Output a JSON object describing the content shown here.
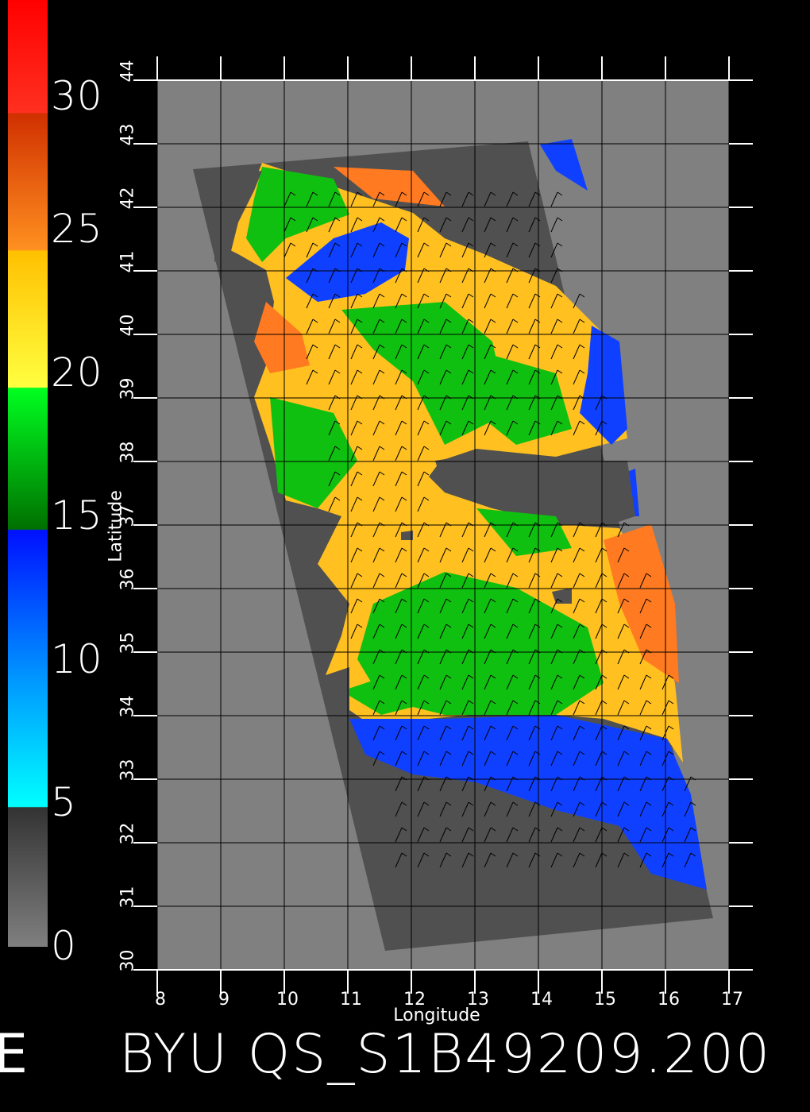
{
  "map": {
    "title": "BYU QS_S1B49209.200",
    "title_left_fragment": "E",
    "xlabel": "Longitude",
    "ylabel": "Latitude",
    "lon_ticks": [
      "8",
      "9",
      "10",
      "11",
      "12",
      "13",
      "14",
      "15",
      "16",
      "17"
    ],
    "lat_ticks": [
      "30",
      "31",
      "32",
      "33",
      "34",
      "35",
      "36",
      "37",
      "38",
      "39",
      "40",
      "41",
      "42",
      "43",
      "44"
    ],
    "lon_range": [
      8,
      17
    ],
    "lat_range": [
      30,
      44
    ],
    "colorbar": {
      "labels": [
        "30",
        "25",
        "20",
        "15",
        "10",
        "5",
        "0"
      ],
      "label_values": [
        30,
        25,
        20,
        15,
        10,
        5,
        0
      ],
      "range": [
        0,
        33
      ],
      "colors": {
        "low": "#7f7f7f",
        "dark": "#333333",
        "cyan": "#00ffff",
        "blue": "#0020ff",
        "dark_green": "#007a00",
        "green": "#00ff00",
        "yellow": "#ffff40",
        "orange": "#ffb000",
        "dark_orange": "#ff7a00",
        "red": "#ff1010"
      }
    },
    "colors": {
      "background": "#000000",
      "land": "#808080",
      "swath_nodata": "#505050",
      "grid": "#000000",
      "frame": "#ffffff"
    }
  }
}
